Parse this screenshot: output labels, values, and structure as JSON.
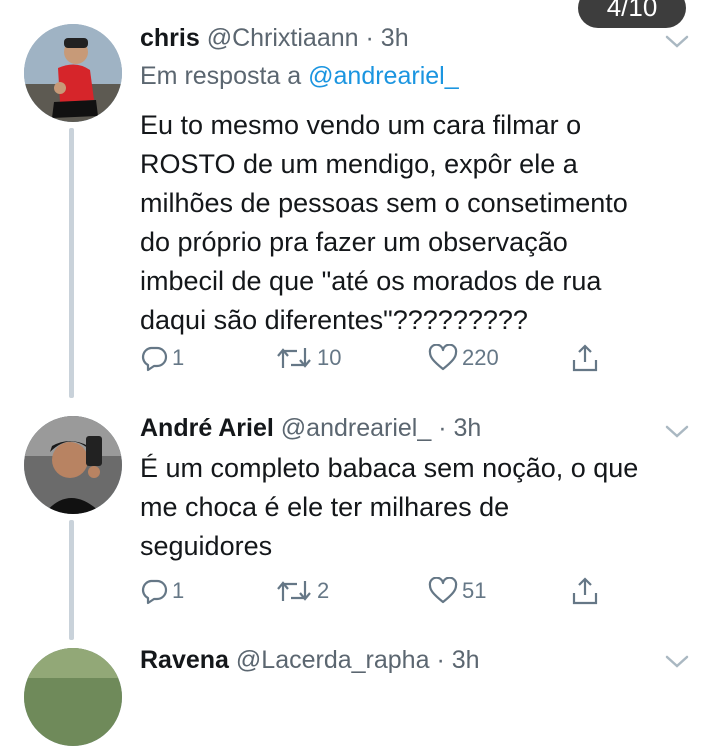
{
  "page_counter": "4/10",
  "tweets": [
    {
      "name": "chris",
      "handle": "@Chrixtiaann",
      "time": "3h",
      "reply_prefix": "Em resposta a",
      "reply_to": "@andreariel_",
      "text": "Eu to mesmo vendo um cara filmar o\nROSTO de um mendigo, expôr ele a\nmilhões de pessoas sem o consetimento\ndo próprio pra fazer um observação\nimbecil de que \"até os morados de rua\ndaqui são diferentes\"?????????",
      "replies": "1",
      "retweets": "10",
      "likes": "220"
    },
    {
      "name": "André Ariel",
      "handle": "@andreariel_",
      "time": "3h",
      "text": "É um completo babaca sem noção, o que\nme choca é ele ter milhares de\nseguidores",
      "replies": "1",
      "retweets": "2",
      "likes": "51"
    },
    {
      "name": "Ravena",
      "handle": "@Lacerda_rapha",
      "time": "3h"
    }
  ],
  "icons": {
    "reply": "reply-icon",
    "retweet": "retweet-icon",
    "like": "heart-icon",
    "share": "share-icon",
    "more": "chevron-down-icon"
  },
  "colors": {
    "link": "#1b95e0",
    "muted": "#5b6670",
    "thread_line": "#c9d2da"
  }
}
